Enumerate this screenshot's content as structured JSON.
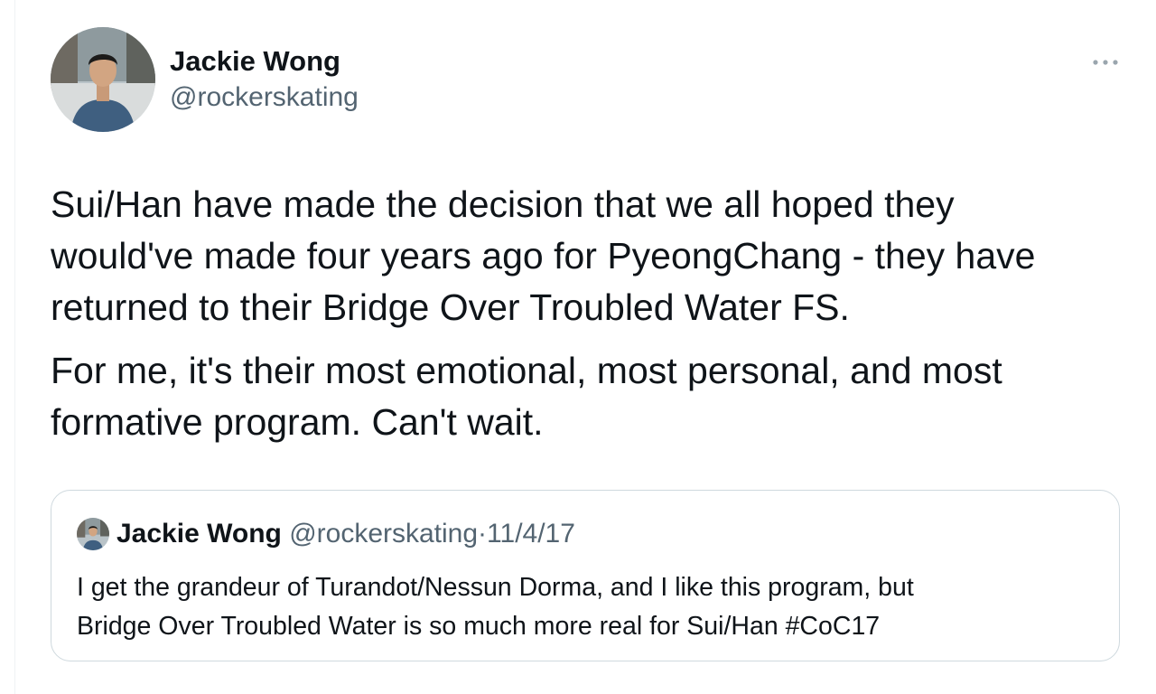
{
  "tweet": {
    "author_name": "Jackie Wong",
    "author_handle": "@rockerskating",
    "more_icon": "more-horizontal-icon",
    "paragraphs": [
      "Sui/Han have made the decision that we all hoped they\nwould've made four years ago for PyeongChang - they have\nreturned to their Bridge Over Troubled Water FS.",
      "For me, it's their most emotional, most personal, and most\nformative program. Can't wait."
    ]
  },
  "quote": {
    "author_name": "Jackie Wong",
    "author_handle": "@rockerskating",
    "separator": "·",
    "date": "11/4/17",
    "text": "I get the grandeur of Turandot/Nessun Dorma, and I like this program, but\nBridge Over Troubled Water is so much more real for Sui/Han #CoC17"
  },
  "colors": {
    "text_primary": "#0f1419",
    "text_secondary": "#536471",
    "border": "#cfd9de"
  }
}
